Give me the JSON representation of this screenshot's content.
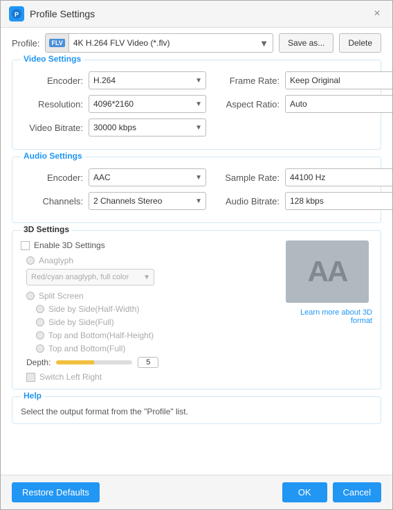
{
  "titleBar": {
    "icon": "PS",
    "title": "Profile Settings",
    "closeLabel": "×"
  },
  "profile": {
    "label": "Profile:",
    "value": "4K H.264 FLV Video (*.flv)",
    "badge": "FLV",
    "saveAsLabel": "Save as...",
    "deleteLabel": "Delete"
  },
  "videoSettings": {
    "sectionTitle": "Video Settings",
    "encoderLabel": "Encoder:",
    "encoderValue": "H.264",
    "resolutionLabel": "Resolution:",
    "resolutionValue": "4096*2160",
    "videoBitrateLabel": "Video Bitrate:",
    "videoBitrateValue": "30000 kbps",
    "frameRateLabel": "Frame Rate:",
    "frameRateValue": "Keep Original",
    "aspectRatioLabel": "Aspect Ratio:",
    "aspectRatioValue": "Auto"
  },
  "audioSettings": {
    "sectionTitle": "Audio Settings",
    "encoderLabel": "Encoder:",
    "encoderValue": "AAC",
    "channelsLabel": "Channels:",
    "channelsValue": "2 Channels Stereo",
    "sampleRateLabel": "Sample Rate:",
    "sampleRateValue": "44100 Hz",
    "audioBitrateLabel": "Audio Bitrate:",
    "audioBitrateValue": "128 kbps"
  },
  "settings3d": {
    "sectionTitle": "3D Settings",
    "enableLabel": "Enable 3D Settings",
    "anaglyphLabel": "Anaglyph",
    "anaglyphValue": "Red/cyan anaglyph, full color",
    "splitScreenLabel": "Split Screen",
    "splitOptions": [
      "Side by Side(Half-Width)",
      "Side by Side(Full)",
      "Top and Bottom(Half-Height)",
      "Top and Bottom(Full)"
    ],
    "depthLabel": "Depth:",
    "depthValue": "5",
    "switchLabel": "Switch Left Right",
    "previewLetters": "AA",
    "learnMoreLabel": "Learn more about 3D format"
  },
  "help": {
    "sectionTitle": "Help",
    "helpText": "Select the output format from the \"Profile\" list."
  },
  "footer": {
    "restoreLabel": "Restore Defaults",
    "okLabel": "OK",
    "cancelLabel": "Cancel"
  }
}
